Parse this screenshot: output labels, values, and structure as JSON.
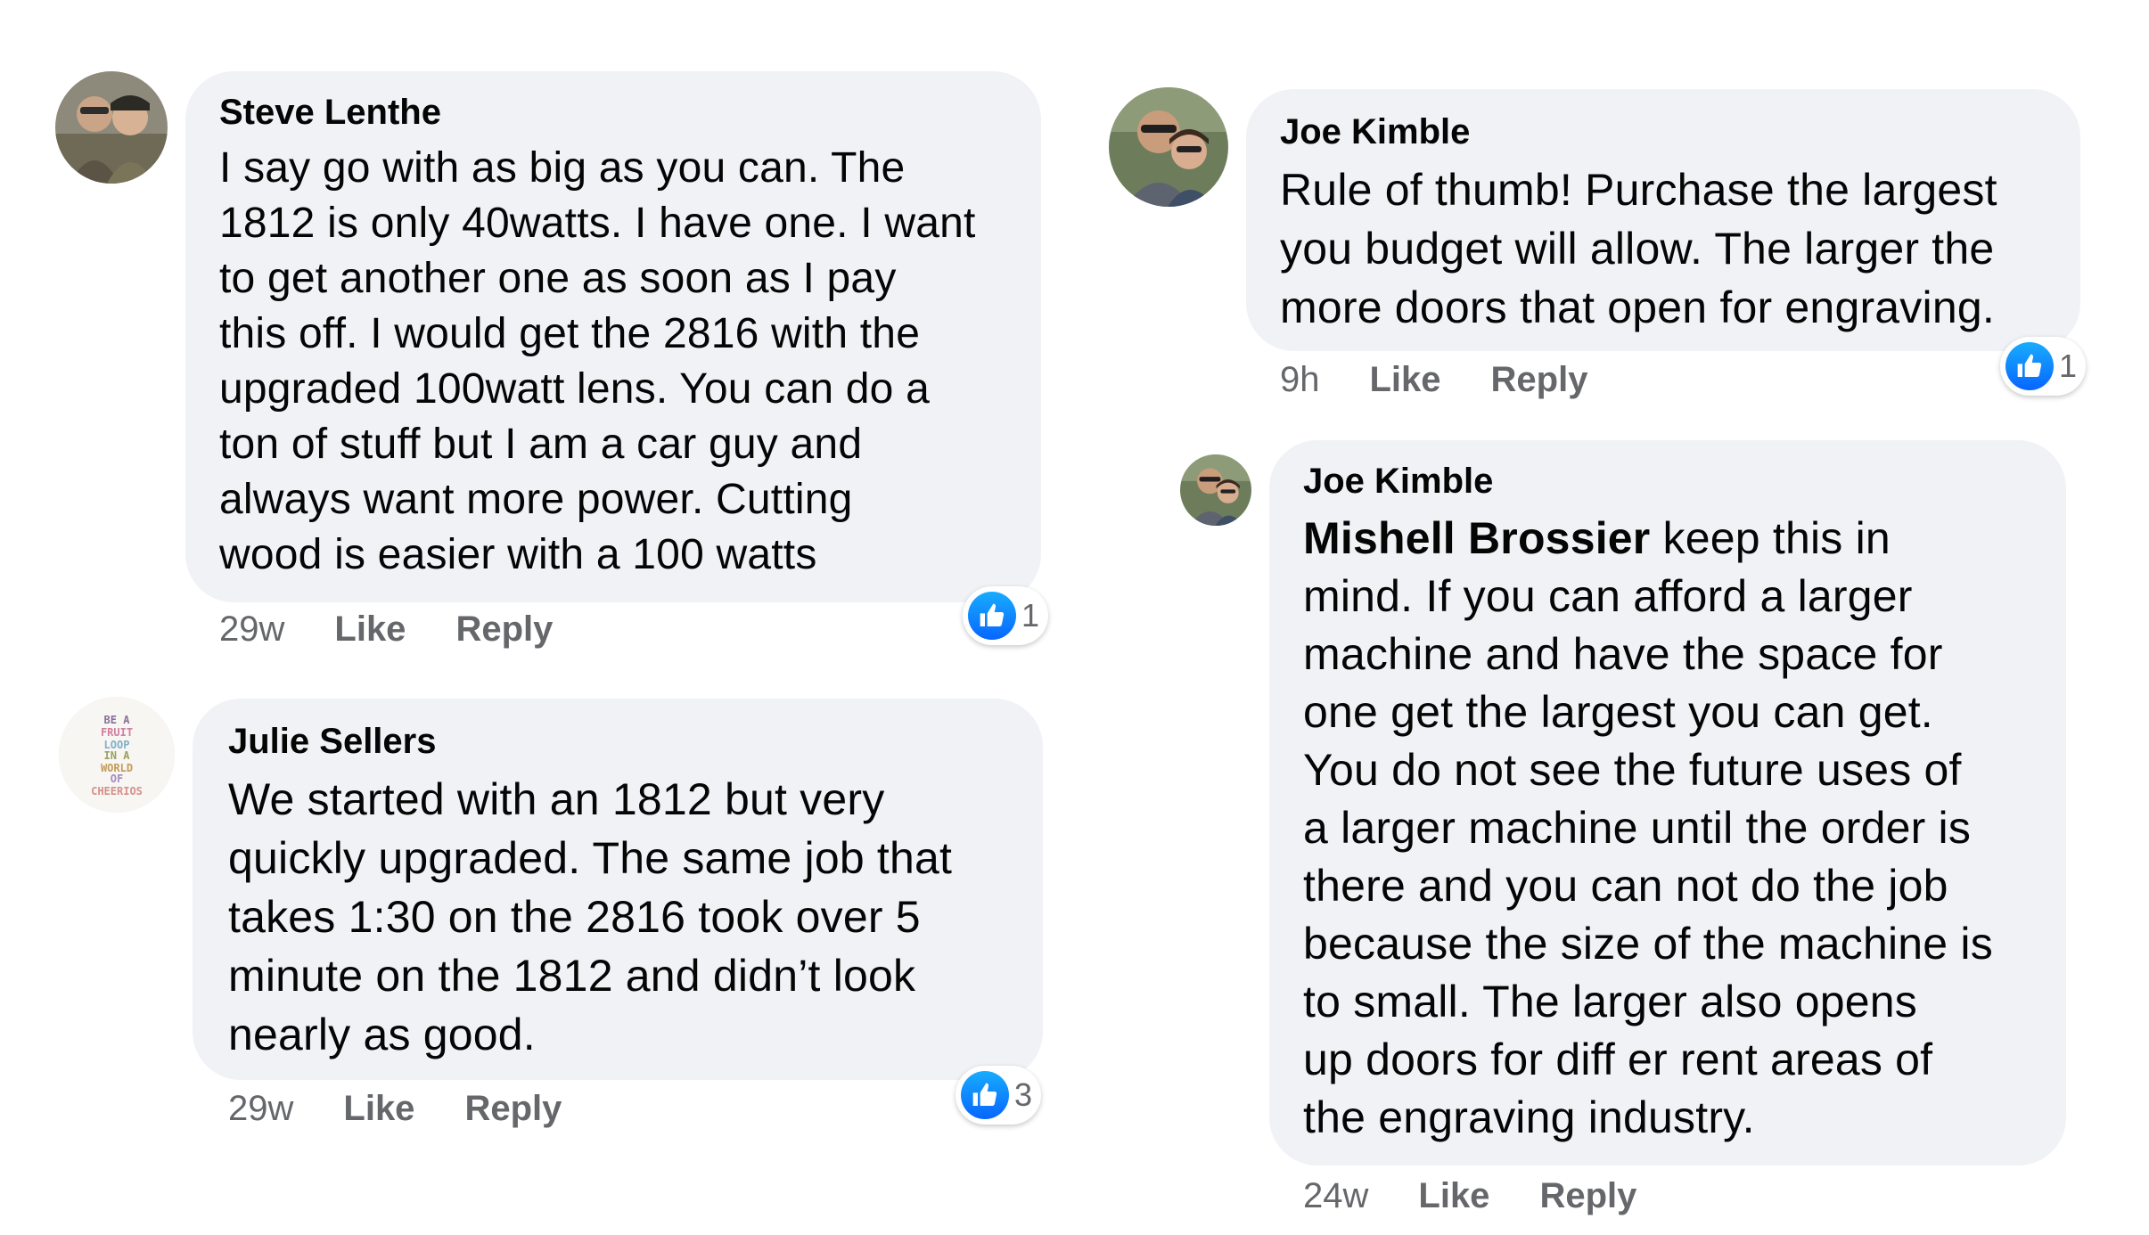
{
  "colors": {
    "bubble": "#f0f2f5",
    "meta_text": "#65676b",
    "like_blue": "#1877f2",
    "text": "#050505"
  },
  "comments": [
    {
      "author": "Steve Lenthe",
      "lines": [
        "I say go with as big as you can. The",
        "1812 is only 40watts. I have one. I want",
        "to get another one as soon as I pay",
        "this off. I would get the 2816 with the",
        "upgraded 100watt lens. You can do a",
        "ton of stuff but I am a car guy and",
        "always want more power. Cutting",
        "wood is easier with a 100 watts"
      ],
      "time": "29w",
      "like_label": "Like",
      "reply_label": "Reply",
      "reactions": "1",
      "reaction_icon": "thumbs-up-icon"
    },
    {
      "author": "Julie Sellers",
      "lines": [
        "We started with an 1812 but very",
        "quickly upgraded. The same job that",
        "takes 1:30 on the 2816 took over 5",
        "minute on the 1812 and didn’t look",
        "nearly as good."
      ],
      "time": "29w",
      "like_label": "Like",
      "reply_label": "Reply",
      "reactions": "3",
      "reaction_icon": "thumbs-up-icon",
      "avatar_text": "BE A FRUIT LOOP IN A WORLD OF CHEERIOS"
    },
    {
      "author": "Joe Kimble",
      "lines": [
        "Rule of thumb! Purchase the largest",
        "you budget will allow. The larger the",
        "more doors that open for engraving."
      ],
      "time": "9h",
      "like_label": "Like",
      "reply_label": "Reply",
      "reactions": "1",
      "reaction_icon": "thumbs-up-icon"
    },
    {
      "author": "Joe Kimble",
      "mention": "Mishell Brossier",
      "first_line_rest": " keep this in",
      "lines": [
        "mind.  If you can afford a larger",
        "machine and have the space for",
        "one get the largest you can get.",
        "You do not see the future uses of",
        "a larger machine until the order is",
        "there and you can not do the job",
        "because the size of the machine is",
        "to small. The larger  also opens",
        "up doors for diff er rent areas of",
        "the engraving industry."
      ],
      "time": "24w",
      "like_label": "Like",
      "reply_label": "Reply"
    }
  ]
}
